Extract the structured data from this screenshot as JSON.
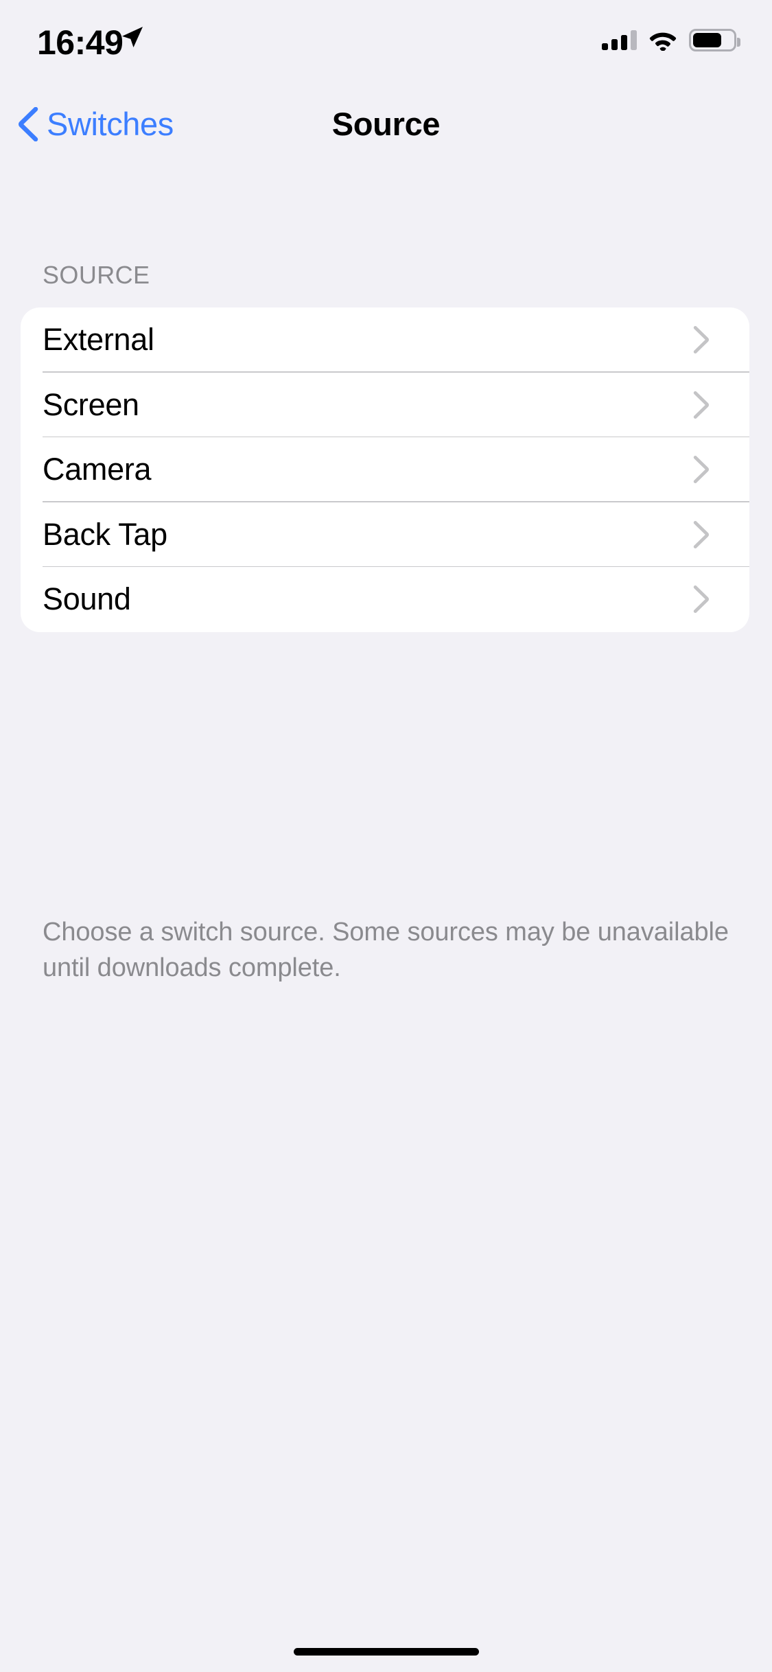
{
  "status_bar": {
    "time": "16:49",
    "location_icon": "location-arrow-icon",
    "signal_icon": "cellular-signal-icon",
    "signal_bars_filled": 3,
    "signal_bars_total": 4,
    "wifi_icon": "wifi-icon",
    "battery_icon": "battery-icon",
    "battery_percent": 65
  },
  "nav": {
    "back_label": "Switches",
    "back_icon": "chevron-left-icon",
    "title": "Source"
  },
  "section": {
    "header": "SOURCE",
    "rows": [
      {
        "label": "External",
        "chevron": "chevron-right-icon"
      },
      {
        "label": "Screen",
        "chevron": "chevron-right-icon"
      },
      {
        "label": "Camera",
        "chevron": "chevron-right-icon"
      },
      {
        "label": "Back Tap",
        "chevron": "chevron-right-icon"
      },
      {
        "label": "Sound",
        "chevron": "chevron-right-icon"
      }
    ],
    "footer": "Choose a switch source. Some sources may be unavailable until downloads complete."
  },
  "colors": {
    "background": "#F2F1F6",
    "card": "#FFFFFF",
    "accent_blue": "#3C7EFF",
    "secondary_text": "#8A8A8E",
    "separator": "#C9C9CC",
    "chevron": "#C4C4C6"
  },
  "home_indicator": "home-indicator"
}
